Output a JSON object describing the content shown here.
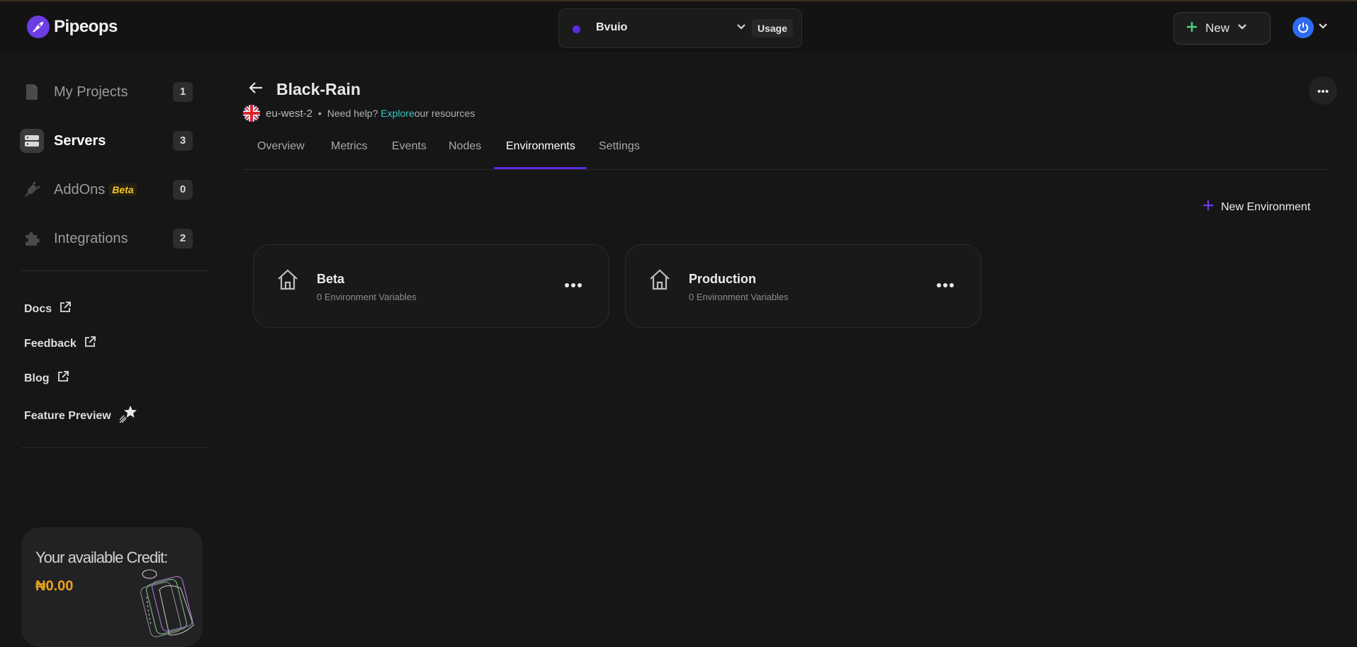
{
  "brand": {
    "name": "Pipeops"
  },
  "workspace": {
    "name": "Bvuio",
    "usage_label": "Usage"
  },
  "header": {
    "new_label": "New"
  },
  "sidebar": {
    "items": [
      {
        "label": "My Projects",
        "count": "1"
      },
      {
        "label": "Servers",
        "count": "3"
      },
      {
        "label": "AddOns",
        "badge": "Beta",
        "count": "0"
      },
      {
        "label": "Integrations",
        "count": "2"
      }
    ],
    "links": [
      {
        "label": "Docs"
      },
      {
        "label": "Feedback"
      },
      {
        "label": "Blog"
      },
      {
        "label": "Feature Preview"
      }
    ],
    "credit": {
      "title": "Your available Credit:",
      "amount": "₦0.00"
    }
  },
  "server": {
    "name": "Black-Rain",
    "region": "eu-west-2",
    "separator": "•",
    "help_text": "Need help?",
    "explore_link": "Explore",
    "resources_text": "our resources"
  },
  "tabs": [
    "Overview",
    "Metrics",
    "Events",
    "Nodes",
    "Environments",
    "Settings"
  ],
  "active_tab": "Environments",
  "new_environment_label": "New Environment",
  "environments": [
    {
      "name": "Beta",
      "variables": "0 Environment Variables"
    },
    {
      "name": "Production",
      "variables": "0 Environment Variables"
    }
  ],
  "colors": {
    "accent": "#5b2be0",
    "link": "#37c7c2",
    "credit": "#e9a21e",
    "beta": "#f4c623"
  }
}
